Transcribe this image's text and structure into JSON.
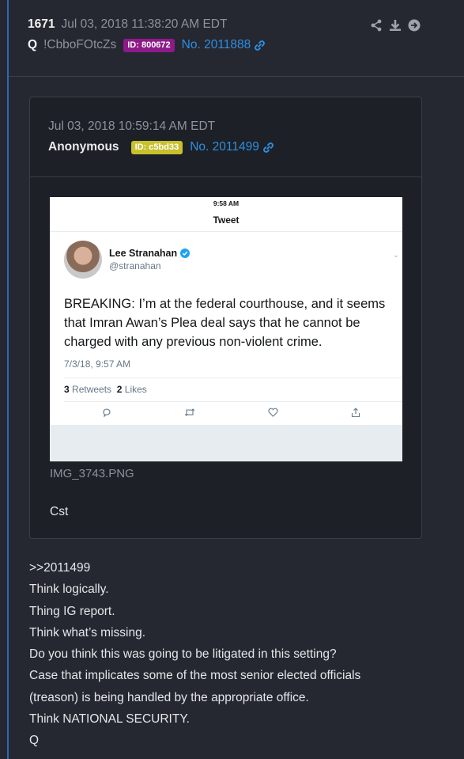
{
  "post": {
    "number": "1671",
    "timestamp": "Jul 03, 2018 11:38:20 AM EDT",
    "author": "Q",
    "tripcode": "!CbboFOtcZs",
    "id_badge": "ID: 800672",
    "post_no": "No. 2011888",
    "actions": [
      "share-icon",
      "download-icon",
      "go-arrow-icon"
    ]
  },
  "quote": {
    "timestamp": "Jul 03, 2018 10:59:14 AM EDT",
    "author": "Anonymous",
    "id_badge": "ID: c5bd33",
    "post_no": "No. 2011499",
    "file_name": "IMG_3743.PNG",
    "body": "Cst",
    "tweet": {
      "status_time": "9:58 AM",
      "header": "Tweet",
      "name": "Lee Stranahan",
      "handle": "@stranahan",
      "text": "BREAKING: I’m at the federal courthouse, and it seems that Imran Awan’s Plea deal says that he cannot be charged with any previous non-violent crime.",
      "date": "7/3/18, 9:57 AM",
      "retweets_count": "3",
      "retweets_label": "Retweets",
      "likes_count": "2",
      "likes_label": "Likes"
    }
  },
  "message": {
    "lines": [
      ">>2011499",
      "Think logically.",
      "Thing IG report.",
      "Think what’s missing.",
      "Do you think this was going to be litigated in this setting?",
      "Case that implicates some of the most senior elected officials",
      "(treason) is being handled by the appropriate office.",
      "Think NATIONAL SECURITY.",
      "Q"
    ]
  },
  "colors": {
    "background": "#252830",
    "card": "#1d2027",
    "link": "#2e8fe0",
    "id_purple": "#8e1a8a",
    "id_yellow": "#c7c12d",
    "rule": "#2f68b6"
  }
}
